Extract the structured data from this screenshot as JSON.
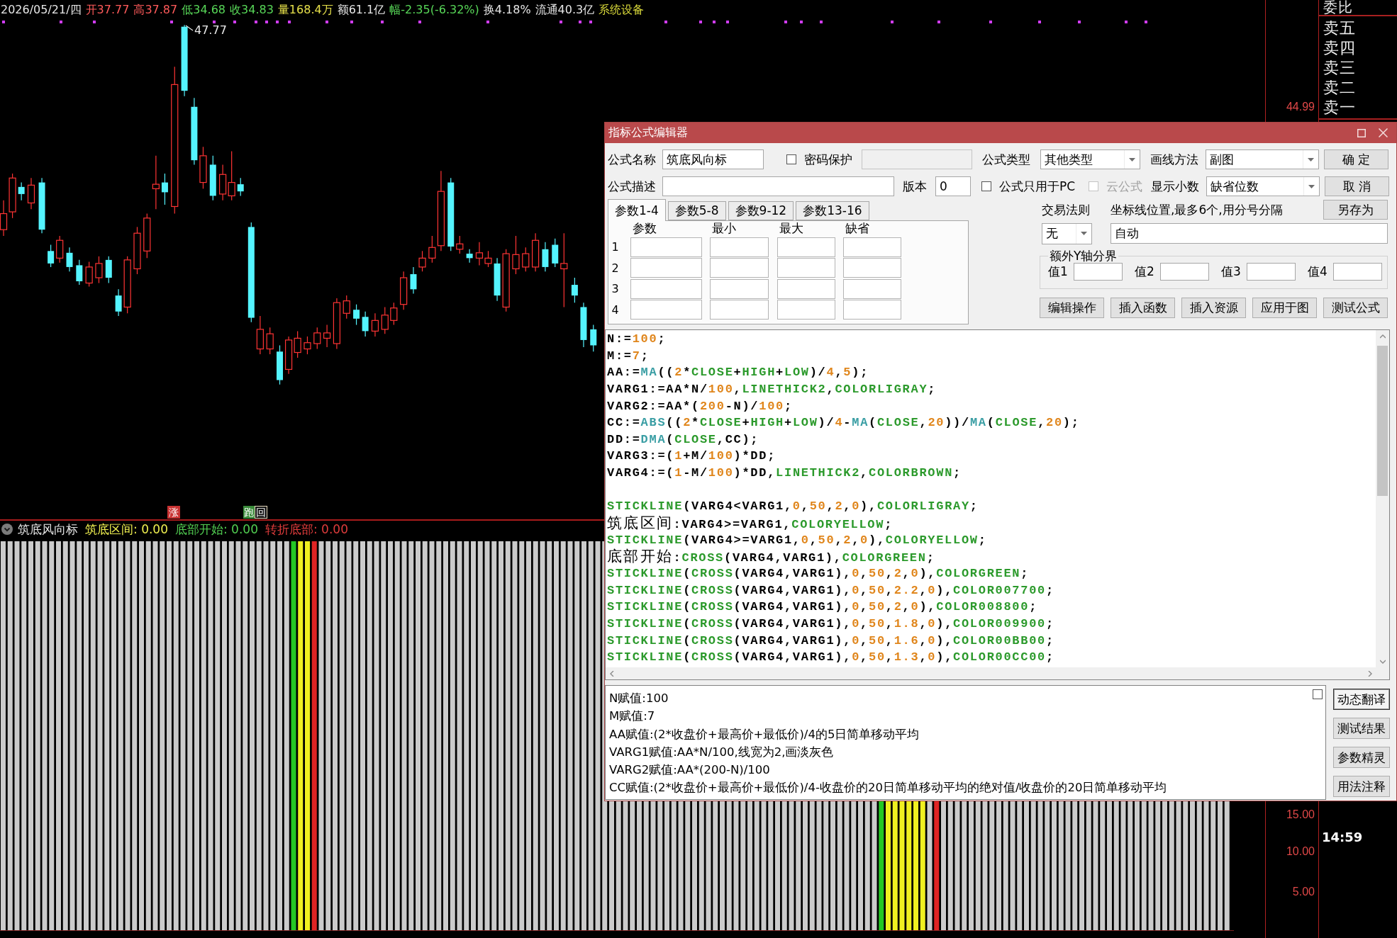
{
  "quote_bar": [
    {
      "text": "2026/05/21/四",
      "color": "#e6e6e6"
    },
    {
      "text": "开37.77",
      "color": "#ff5a5a"
    },
    {
      "text": "高37.87",
      "color": "#ff5a5a"
    },
    {
      "text": "低34.68",
      "color": "#58d858"
    },
    {
      "text": "收34.83",
      "color": "#58d858"
    },
    {
      "text": "量168.4万",
      "color": "#e6e04a"
    },
    {
      "text": "额61.1亿",
      "color": "#e6e6e6"
    },
    {
      "text": "幅-2.35(-6.32%)",
      "color": "#58d858"
    },
    {
      "text": "换4.18%",
      "color": "#e6e6e6"
    },
    {
      "text": "流通40.3亿",
      "color": "#e6e6e6"
    },
    {
      "text": "系统设备",
      "color": "#d8d83a"
    }
  ],
  "price_chart": {
    "high_label": "47.77",
    "markers": [
      {
        "text": "涨",
        "kind": "solid"
      },
      {
        "text": "跑回",
        "kind": "split"
      }
    ]
  },
  "price_axis": [
    "44.99"
  ],
  "indicator": {
    "name": "筑底风向标",
    "readings": [
      {
        "text": "筑底区间: 0.00",
        "color": "#f0f050"
      },
      {
        "text": "底部开始: 0.00",
        "color": "#52d052"
      },
      {
        "text": "转折底部: 0.00",
        "color": "#e03c3c"
      }
    ]
  },
  "indicator_axis": [
    "15.00",
    "10.00",
    "5.00"
  ],
  "order_book": {
    "header": "委比",
    "levels": [
      "卖五",
      "卖四",
      "卖三",
      "卖二",
      "卖一"
    ],
    "time": "14:59"
  },
  "dialog": {
    "title": "指标公式编辑器",
    "formula_name": {
      "label": "公式名称",
      "value": "筑底风向标"
    },
    "password_protect": {
      "label": "密码保护",
      "checked": false
    },
    "formula_type": {
      "label": "公式类型",
      "value": "其他类型"
    },
    "draw_method": {
      "label": "画线方法",
      "value": "副图"
    },
    "description": {
      "label": "公式描述"
    },
    "version": {
      "label": "版本",
      "value": "0"
    },
    "pc_only": {
      "label": "公式只用于PC",
      "checked": false
    },
    "cloud_formula": {
      "label": "云公式",
      "checked": false,
      "disabled": true
    },
    "decimals": {
      "label": "显示小数",
      "value": "缺省位数"
    },
    "side_buttons": [
      "确 定",
      "取 消",
      "另存为"
    ],
    "param_tabs": [
      {
        "label": "参数1-4",
        "selected": true
      },
      {
        "label": "参数5-8",
        "selected": false
      },
      {
        "label": "参数9-12",
        "selected": false
      },
      {
        "label": "参数13-16",
        "selected": false
      }
    ],
    "param_table": {
      "columns": [
        "参数",
        "最小",
        "最大",
        "缺省"
      ],
      "rows": [
        "1",
        "2",
        "3",
        "4"
      ]
    },
    "trade_rule": {
      "label": "交易法则",
      "value": "无"
    },
    "axis_lines": {
      "label": "坐标线位置,最多6个,用分号分隔",
      "value": "自动"
    },
    "extra_y_axis": {
      "title": "额外Y轴分界",
      "fields": [
        "值1",
        "值2",
        "值3",
        "值4"
      ]
    },
    "action_buttons": [
      "编辑操作",
      "插入函数",
      "插入资源",
      "应用于图",
      "测试公式"
    ],
    "code_blocks": [
      [
        [
          {
            "text": "N:=",
            "kind": "plain"
          },
          {
            "text": "100",
            "kind": "number"
          },
          {
            "text": ";",
            "kind": "plain"
          }
        ],
        [
          {
            "text": "M:=",
            "kind": "plain"
          },
          {
            "text": "7",
            "kind": "number"
          },
          {
            "text": ";",
            "kind": "plain"
          }
        ],
        [
          {
            "text": "AA:=",
            "kind": "plain"
          },
          {
            "text": "MA",
            "kind": "function"
          },
          {
            "text": "((",
            "kind": "plain"
          },
          {
            "text": "2",
            "kind": "number"
          },
          {
            "text": "*",
            "kind": "plain"
          },
          {
            "text": "CLOSE",
            "kind": "keyword"
          },
          {
            "text": "+",
            "kind": "plain"
          },
          {
            "text": "HIGH",
            "kind": "keyword"
          },
          {
            "text": "+",
            "kind": "plain"
          },
          {
            "text": "LOW",
            "kind": "keyword"
          },
          {
            "text": ")/",
            "kind": "plain"
          },
          {
            "text": "4",
            "kind": "number"
          },
          {
            "text": ",",
            "kind": "plain"
          },
          {
            "text": "5",
            "kind": "number"
          },
          {
            "text": ");",
            "kind": "plain"
          }
        ],
        [
          {
            "text": "VARG1:=AA*N/",
            "kind": "plain"
          },
          {
            "text": "100",
            "kind": "number"
          },
          {
            "text": ",",
            "kind": "plain"
          },
          {
            "text": "LINETHICK2",
            "kind": "keyword"
          },
          {
            "text": ",",
            "kind": "plain"
          },
          {
            "text": "COLORLIGRAY",
            "kind": "keyword"
          },
          {
            "text": ";",
            "kind": "plain"
          }
        ],
        [
          {
            "text": "VARG2:=AA*(",
            "kind": "plain"
          },
          {
            "text": "200",
            "kind": "number"
          },
          {
            "text": "-N)/",
            "kind": "plain"
          },
          {
            "text": "100",
            "kind": "number"
          },
          {
            "text": ";",
            "kind": "plain"
          }
        ],
        [
          {
            "text": "CC:=",
            "kind": "plain"
          },
          {
            "text": "ABS",
            "kind": "function"
          },
          {
            "text": "((",
            "kind": "plain"
          },
          {
            "text": "2",
            "kind": "number"
          },
          {
            "text": "*",
            "kind": "plain"
          },
          {
            "text": "CLOSE",
            "kind": "keyword"
          },
          {
            "text": "+",
            "kind": "plain"
          },
          {
            "text": "HIGH",
            "kind": "keyword"
          },
          {
            "text": "+",
            "kind": "plain"
          },
          {
            "text": "LOW",
            "kind": "keyword"
          },
          {
            "text": ")/",
            "kind": "plain"
          },
          {
            "text": "4",
            "kind": "number"
          },
          {
            "text": "-",
            "kind": "plain"
          },
          {
            "text": "MA",
            "kind": "function"
          },
          {
            "text": "(",
            "kind": "plain"
          },
          {
            "text": "CLOSE",
            "kind": "keyword"
          },
          {
            "text": ",",
            "kind": "plain"
          },
          {
            "text": "20",
            "kind": "number"
          },
          {
            "text": "))/",
            "kind": "plain"
          },
          {
            "text": "MA",
            "kind": "function"
          },
          {
            "text": "(",
            "kind": "plain"
          },
          {
            "text": "CLOSE",
            "kind": "keyword"
          },
          {
            "text": ",",
            "kind": "plain"
          },
          {
            "text": "20",
            "kind": "number"
          },
          {
            "text": ");",
            "kind": "plain"
          }
        ],
        [
          {
            "text": "DD:=",
            "kind": "plain"
          },
          {
            "text": "DMA",
            "kind": "function"
          },
          {
            "text": "(",
            "kind": "plain"
          },
          {
            "text": "CLOSE",
            "kind": "keyword"
          },
          {
            "text": ",CC);",
            "kind": "plain"
          }
        ],
        [
          {
            "text": "VARG3:=(",
            "kind": "plain"
          },
          {
            "text": "1",
            "kind": "number"
          },
          {
            "text": "+M/",
            "kind": "plain"
          },
          {
            "text": "100",
            "kind": "number"
          },
          {
            "text": ")*DD;",
            "kind": "plain"
          }
        ],
        [
          {
            "text": "VARG4:=(",
            "kind": "plain"
          },
          {
            "text": "1",
            "kind": "number"
          },
          {
            "text": "-M/",
            "kind": "plain"
          },
          {
            "text": "100",
            "kind": "number"
          },
          {
            "text": ")*DD,",
            "kind": "plain"
          },
          {
            "text": "LINETHICK2",
            "kind": "keyword"
          },
          {
            "text": ",",
            "kind": "plain"
          },
          {
            "text": "COLORBROWN",
            "kind": "keyword"
          },
          {
            "text": ";",
            "kind": "plain"
          }
        ]
      ],
      [
        [
          {
            "text": "STICKLINE",
            "kind": "keyword"
          },
          {
            "text": "(VARG4<VARG1,",
            "kind": "plain"
          },
          {
            "text": "0",
            "kind": "number"
          },
          {
            "text": ",",
            "kind": "plain"
          },
          {
            "text": "50",
            "kind": "number"
          },
          {
            "text": ",",
            "kind": "plain"
          },
          {
            "text": "2",
            "kind": "number"
          },
          {
            "text": ",",
            "kind": "plain"
          },
          {
            "text": "0",
            "kind": "number"
          },
          {
            "text": "),",
            "kind": "plain"
          },
          {
            "text": "COLORLIGRAY",
            "kind": "keyword"
          },
          {
            "text": ";",
            "kind": "plain"
          }
        ],
        [
          {
            "text": "筑底区间",
            "kind": "label"
          },
          {
            "text": ":VARG4>=VARG1,",
            "kind": "plain"
          },
          {
            "text": "COLORYELLOW",
            "kind": "keyword"
          },
          {
            "text": ";",
            "kind": "plain"
          }
        ],
        [
          {
            "text": "STICKLINE",
            "kind": "keyword"
          },
          {
            "text": "(VARG4>=VARG1,",
            "kind": "plain"
          },
          {
            "text": "0",
            "kind": "number"
          },
          {
            "text": ",",
            "kind": "plain"
          },
          {
            "text": "50",
            "kind": "number"
          },
          {
            "text": ",",
            "kind": "plain"
          },
          {
            "text": "2",
            "kind": "number"
          },
          {
            "text": ",",
            "kind": "plain"
          },
          {
            "text": "0",
            "kind": "number"
          },
          {
            "text": "),",
            "kind": "plain"
          },
          {
            "text": "COLORYELLOW",
            "kind": "keyword"
          },
          {
            "text": ";",
            "kind": "plain"
          }
        ],
        [
          {
            "text": "底部开始",
            "kind": "label"
          },
          {
            "text": ":",
            "kind": "plain"
          },
          {
            "text": "CROSS",
            "kind": "keyword"
          },
          {
            "text": "(VARG4,VARG1),",
            "kind": "plain"
          },
          {
            "text": "COLORGREEN",
            "kind": "keyword"
          },
          {
            "text": ";",
            "kind": "plain"
          }
        ],
        [
          {
            "text": "STICKLINE",
            "kind": "keyword"
          },
          {
            "text": "(",
            "kind": "plain"
          },
          {
            "text": "CROSS",
            "kind": "keyword"
          },
          {
            "text": "(VARG4,VARG1),",
            "kind": "plain"
          },
          {
            "text": "0",
            "kind": "number"
          },
          {
            "text": ",",
            "kind": "plain"
          },
          {
            "text": "50",
            "kind": "number"
          },
          {
            "text": ",",
            "kind": "plain"
          },
          {
            "text": "2",
            "kind": "number"
          },
          {
            "text": ",",
            "kind": "plain"
          },
          {
            "text": "0",
            "kind": "number"
          },
          {
            "text": "),",
            "kind": "plain"
          },
          {
            "text": "COLORGREEN",
            "kind": "keyword"
          },
          {
            "text": ";",
            "kind": "plain"
          }
        ],
        [
          {
            "text": "STICKLINE",
            "kind": "keyword"
          },
          {
            "text": "(",
            "kind": "plain"
          },
          {
            "text": "CROSS",
            "kind": "keyword"
          },
          {
            "text": "(VARG4,VARG1),",
            "kind": "plain"
          },
          {
            "text": "0",
            "kind": "number"
          },
          {
            "text": ",",
            "kind": "plain"
          },
          {
            "text": "50",
            "kind": "number"
          },
          {
            "text": ",",
            "kind": "plain"
          },
          {
            "text": "2.2",
            "kind": "number"
          },
          {
            "text": ",",
            "kind": "plain"
          },
          {
            "text": "0",
            "kind": "number"
          },
          {
            "text": "),",
            "kind": "plain"
          },
          {
            "text": "COLOR007700",
            "kind": "keyword"
          },
          {
            "text": ";",
            "kind": "plain"
          }
        ],
        [
          {
            "text": "STICKLINE",
            "kind": "keyword"
          },
          {
            "text": "(",
            "kind": "plain"
          },
          {
            "text": "CROSS",
            "kind": "keyword"
          },
          {
            "text": "(VARG4,VARG1),",
            "kind": "plain"
          },
          {
            "text": "0",
            "kind": "number"
          },
          {
            "text": ",",
            "kind": "plain"
          },
          {
            "text": "50",
            "kind": "number"
          },
          {
            "text": ",",
            "kind": "plain"
          },
          {
            "text": "2",
            "kind": "number"
          },
          {
            "text": ",",
            "kind": "plain"
          },
          {
            "text": "0",
            "kind": "number"
          },
          {
            "text": "),",
            "kind": "plain"
          },
          {
            "text": "COLOR008800",
            "kind": "keyword"
          },
          {
            "text": ";",
            "kind": "plain"
          }
        ],
        [
          {
            "text": "STICKLINE",
            "kind": "keyword"
          },
          {
            "text": "(",
            "kind": "plain"
          },
          {
            "text": "CROSS",
            "kind": "keyword"
          },
          {
            "text": "(VARG4,VARG1),",
            "kind": "plain"
          },
          {
            "text": "0",
            "kind": "number"
          },
          {
            "text": ",",
            "kind": "plain"
          },
          {
            "text": "50",
            "kind": "number"
          },
          {
            "text": ",",
            "kind": "plain"
          },
          {
            "text": "1.8",
            "kind": "number"
          },
          {
            "text": ",",
            "kind": "plain"
          },
          {
            "text": "0",
            "kind": "number"
          },
          {
            "text": "),",
            "kind": "plain"
          },
          {
            "text": "COLOR009900",
            "kind": "keyword"
          },
          {
            "text": ";",
            "kind": "plain"
          }
        ],
        [
          {
            "text": "STICKLINE",
            "kind": "keyword"
          },
          {
            "text": "(",
            "kind": "plain"
          },
          {
            "text": "CROSS",
            "kind": "keyword"
          },
          {
            "text": "(VARG4,VARG1),",
            "kind": "plain"
          },
          {
            "text": "0",
            "kind": "number"
          },
          {
            "text": ",",
            "kind": "plain"
          },
          {
            "text": "50",
            "kind": "number"
          },
          {
            "text": ",",
            "kind": "plain"
          },
          {
            "text": "1.6",
            "kind": "number"
          },
          {
            "text": ",",
            "kind": "plain"
          },
          {
            "text": "0",
            "kind": "number"
          },
          {
            "text": "),",
            "kind": "plain"
          },
          {
            "text": "COLOR00BB00",
            "kind": "keyword"
          },
          {
            "text": ";",
            "kind": "plain"
          }
        ],
        [
          {
            "text": "STICKLINE",
            "kind": "keyword"
          },
          {
            "text": "(",
            "kind": "plain"
          },
          {
            "text": "CROSS",
            "kind": "keyword"
          },
          {
            "text": "(VARG4,VARG1),",
            "kind": "plain"
          },
          {
            "text": "0",
            "kind": "number"
          },
          {
            "text": ",",
            "kind": "plain"
          },
          {
            "text": "50",
            "kind": "number"
          },
          {
            "text": ",",
            "kind": "plain"
          },
          {
            "text": "1.3",
            "kind": "number"
          },
          {
            "text": ",",
            "kind": "plain"
          },
          {
            "text": "0",
            "kind": "number"
          },
          {
            "text": "),",
            "kind": "plain"
          },
          {
            "text": "COLOR00CC00",
            "kind": "keyword"
          },
          {
            "text": ";",
            "kind": "plain"
          }
        ]
      ]
    ],
    "translation": {
      "checked": false,
      "lines": [
        "N赋值:100",
        "M赋值:7",
        "AA赋值:(2*收盘价+最高价+最低价)/4的5日简单移动平均",
        "VARG1赋值:AA*N/100,线宽为2,画淡灰色",
        "VARG2赋值:AA*(200-N)/100",
        "CC赋值:(2*收盘价+最高价+最低价)/4-收盘价的20日简单移动平均的绝对值/收盘价的20日简单移动平均"
      ]
    },
    "tool_buttons": [
      {
        "label": "动态翻译",
        "selected": true
      },
      {
        "label": "测试结果",
        "selected": false
      },
      {
        "label": "参数精灵",
        "selected": false
      },
      {
        "label": "用法注释",
        "selected": false
      }
    ]
  }
}
